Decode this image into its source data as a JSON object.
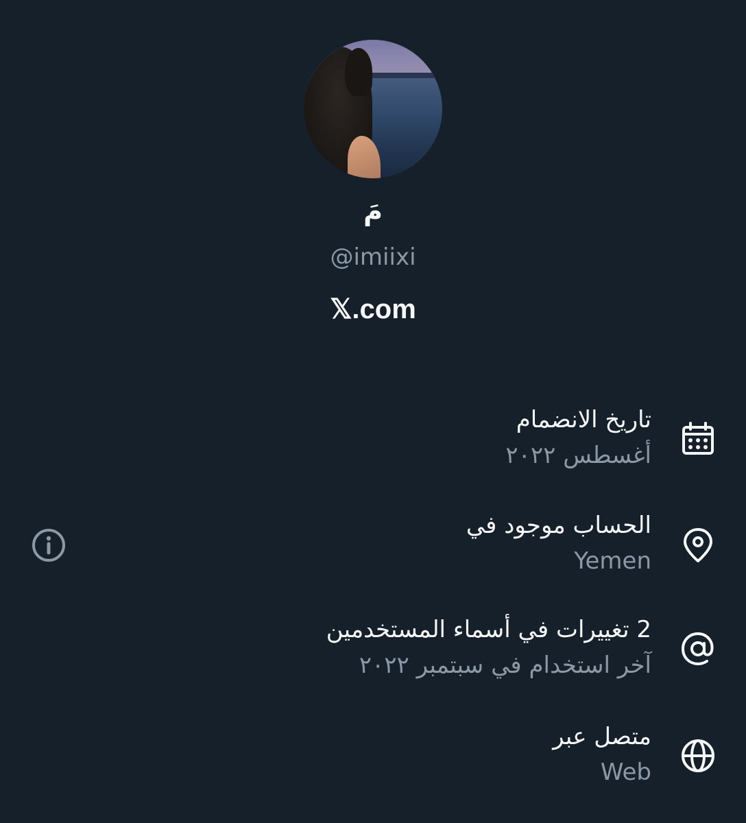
{
  "profile": {
    "display_name": "مَ",
    "handle": "@imiixi",
    "site": "𝕏.com"
  },
  "details": [
    {
      "title": "تاريخ الانضمام",
      "value": "أغسطس ٢٠٢٢",
      "icon": "calendar-icon"
    },
    {
      "title": "الحساب موجود في",
      "value": "Yemen",
      "icon": "location-pin-icon"
    },
    {
      "title": "2 تغييرات في أسماء المستخدمين",
      "value": "آخر استخدام في سبتمبر ٢٠٢٢",
      "icon": "at-sign-icon"
    },
    {
      "title": "متصل عبر",
      "value": "Web",
      "icon": "globe-icon"
    }
  ],
  "colors": {
    "background": "#15202b",
    "primary_text": "#f7f9f9",
    "secondary_text": "#8b98a5"
  }
}
